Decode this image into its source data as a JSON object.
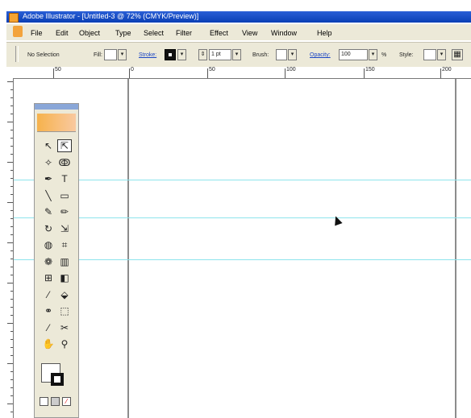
{
  "window": {
    "title": "Adobe Illustrator - [Untitled-3 @ 72% (CMYK/Preview)]"
  },
  "menu": {
    "items": [
      "File",
      "Edit",
      "Object",
      "Type",
      "Select",
      "Filter",
      "Effect",
      "View",
      "Window",
      "Help"
    ]
  },
  "control": {
    "selection": "No Selection",
    "fill_label": "Fill:",
    "stroke_label": "Stroke:",
    "stroke_weight": "1 pt",
    "brush_label": "Brush:",
    "opacity_label": "Opacity:",
    "opacity_value": "100",
    "percent": "%",
    "style_label": "Style:"
  },
  "ruler": {
    "labels": [
      "50",
      "0",
      "50",
      "100",
      "150",
      "200"
    ]
  },
  "toolbox": {
    "tools": [
      {
        "name": "selection-tool",
        "glyph": "↖"
      },
      {
        "name": "direct-selection-tool",
        "glyph": "⇱"
      },
      {
        "name": "magic-wand-tool",
        "glyph": "✧"
      },
      {
        "name": "lasso-tool",
        "glyph": "ↂ"
      },
      {
        "name": "pen-tool",
        "glyph": "✒"
      },
      {
        "name": "type-tool",
        "glyph": "T"
      },
      {
        "name": "line-tool",
        "glyph": "╲"
      },
      {
        "name": "rectangle-tool",
        "glyph": "▭"
      },
      {
        "name": "paintbrush-tool",
        "glyph": "✎"
      },
      {
        "name": "pencil-tool",
        "glyph": "✏"
      },
      {
        "name": "rotate-tool",
        "glyph": "↻"
      },
      {
        "name": "scale-tool",
        "glyph": "⇲"
      },
      {
        "name": "warp-tool",
        "glyph": "◍"
      },
      {
        "name": "free-transform-tool",
        "glyph": "⌗"
      },
      {
        "name": "symbol-sprayer-tool",
        "glyph": "❁"
      },
      {
        "name": "graph-tool",
        "glyph": "▥"
      },
      {
        "name": "mesh-tool",
        "glyph": "⊞"
      },
      {
        "name": "gradient-tool",
        "glyph": "◧"
      },
      {
        "name": "eyedropper-tool",
        "glyph": "⁄"
      },
      {
        "name": "paint-bucket-tool",
        "glyph": "⬙"
      },
      {
        "name": "blend-tool",
        "glyph": "⚭"
      },
      {
        "name": "live-paint-selection-tool",
        "glyph": "⬚"
      },
      {
        "name": "slice-tool",
        "glyph": "⁄"
      },
      {
        "name": "scissors-tool",
        "glyph": "✂"
      },
      {
        "name": "hand-tool",
        "glyph": "✋"
      },
      {
        "name": "zoom-tool",
        "glyph": "⚲"
      }
    ]
  }
}
